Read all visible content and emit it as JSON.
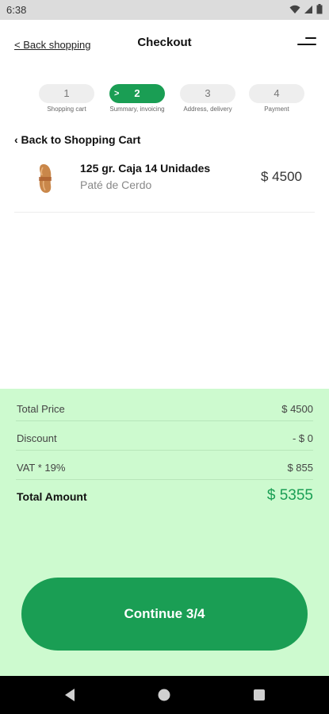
{
  "status_bar": {
    "time": "6:38"
  },
  "header": {
    "back_link": "< Back shopping",
    "title": "Checkout"
  },
  "steps": [
    {
      "number": "1",
      "caption": "Shopping cart"
    },
    {
      "number": "2",
      "caption": "Summary, invoicing"
    },
    {
      "number": "3",
      "caption": "Address, delivery"
    },
    {
      "number": "4",
      "caption": "Payment"
    }
  ],
  "back_to_cart": "‹ Back to Shopping Cart",
  "product": {
    "name": "125 gr. Caja 14 Unidades",
    "subtitle": "Paté de Cerdo",
    "price": "$ 4500"
  },
  "summary": {
    "total_price_label": "Total Price",
    "total_price_value": "$ 4500",
    "discount_label": "Discount",
    "discount_value": "- $ 0",
    "vat_label": "VAT * 19%",
    "vat_value": "$ 855",
    "total_amount_label": "Total Amount",
    "total_amount_value": "$ 5355"
  },
  "continue_label": "Continue 3/4",
  "colors": {
    "accent": "#1a9e54",
    "summary_bg": "#cdfacf",
    "status_bar": "#dcdcdc",
    "nav_bar": "#000000"
  },
  "icons": [
    "wifi-icon",
    "signal-icon",
    "battery-icon",
    "menu-icon",
    "product-thumbnail",
    "back-icon",
    "home-icon",
    "recents-icon"
  ]
}
